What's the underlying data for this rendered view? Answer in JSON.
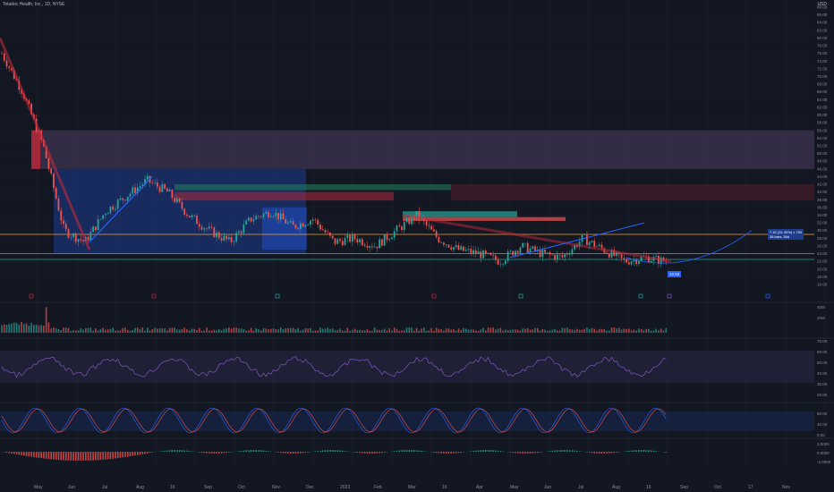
{
  "header": {
    "symbol": "Teladoc Health, Inc., 1D, NYSE",
    "currency": "USD"
  },
  "price_axis_labels": [
    "88.00",
    "86.00",
    "84.00",
    "82.00",
    "80.00",
    "78.00",
    "76.00",
    "74.00",
    "72.00",
    "70.00",
    "68.00",
    "66.00",
    "64.00",
    "62.00",
    "60.00",
    "58.00",
    "56.00",
    "54.00",
    "52.00",
    "50.00",
    "48.00",
    "46.00",
    "44.00",
    "42.00",
    "40.00",
    "38.00",
    "36.00",
    "34.00",
    "32.00",
    "30.00",
    "28.00",
    "26.00",
    "24.00",
    "22.00",
    "20.00",
    "18.00",
    "16.00"
  ],
  "time_axis_labels": [
    "May",
    "Jun",
    "Jul",
    "Aug",
    "16",
    "Sep",
    "Oct",
    "Nov",
    "Dec",
    "2023",
    "Feb",
    "Mar",
    "16",
    "Apr",
    "May",
    "Jun",
    "Jul",
    "Aug",
    "16",
    "Sep",
    "Oct",
    "17",
    "Nov"
  ],
  "badges": {
    "current_price": "22.53",
    "measure_line1": "7.16 (31.30%) ≈ 750",
    "measure_line2": "38 bars, 54d"
  },
  "volume_axis": [
    "40M",
    "20M"
  ],
  "rsi_axis": [
    "70.00",
    "60.00",
    "50.00",
    "40.00",
    "30.00",
    "20.00"
  ],
  "stoch_axis": [
    "80.00",
    "40.00",
    "0.00"
  ],
  "macd_axis": [
    "2.0000",
    "0.0000",
    "-2.0000"
  ],
  "colors": {
    "up": "#26a69a",
    "down": "#ef5350",
    "zone_blue": "#1e3d8f",
    "zone_purple": "#4a3a5e",
    "rsi_line": "#7e57c2"
  },
  "chart_data": {
    "type": "candlestick",
    "title": "Teladoc Health, Inc., 1D, NYSE",
    "ylim": [
      16,
      88
    ],
    "x_months": [
      "May",
      "Jun",
      "Jul",
      "Aug",
      "Sep",
      "Oct",
      "Nov",
      "Dec",
      "2023",
      "Feb",
      "Mar",
      "Apr",
      "May",
      "Jun",
      "Jul",
      "Aug"
    ],
    "close_trend": [
      76,
      66,
      52,
      30,
      27,
      35,
      39,
      43,
      40,
      34,
      30,
      27,
      33,
      35,
      31,
      33,
      27,
      28,
      26,
      30,
      34,
      28,
      25,
      24,
      22,
      26,
      24,
      23,
      28,
      25,
      22,
      23,
      22
    ],
    "zones": [
      {
        "label": "purple supply",
        "y": [
          46,
          56
        ]
      },
      {
        "label": "blue range",
        "y": [
          24,
          46
        ]
      },
      {
        "label": "green supply",
        "y": [
          40.5,
          42
        ]
      },
      {
        "label": "red supply",
        "y": [
          37.8,
          40
        ]
      }
    ],
    "levels": [
      29,
      24,
      22.5
    ],
    "grid": true
  }
}
